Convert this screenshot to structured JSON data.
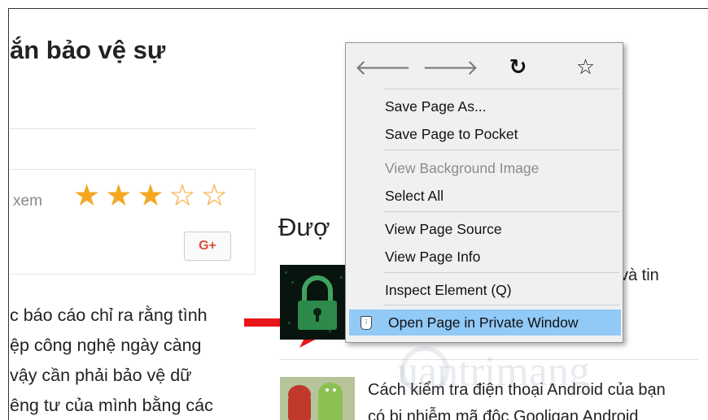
{
  "article": {
    "title": "ắn bảo vệ sự",
    "views_label": "xem",
    "rating": {
      "filled": 3,
      "total": 5
    },
    "share_button": "G+",
    "body_lines": [
      "c báo cáo chỉ ra rằng tình",
      "ệp công nghệ ngày càng",
      " vậy cần phải bảo vệ dữ",
      "êng tư của mình bằng các"
    ]
  },
  "sidebar": {
    "heading": "Đượ",
    "news": [
      {
        "title_fragment": "và tin"
      },
      {
        "title_lines": [
          "Cách kiểm tra điện thoại Android của bạn",
          "có bị nhiễm mã độc Gooligan Android"
        ]
      }
    ],
    "watermark": "uantrimang"
  },
  "context_menu": {
    "nav": [
      {
        "name": "back-icon",
        "glyph": "🡐",
        "enabled": false
      },
      {
        "name": "forward-icon",
        "glyph": "🡒",
        "enabled": false
      },
      {
        "name": "reload-icon",
        "glyph": "↻",
        "enabled": true
      },
      {
        "name": "bookmark-star-icon",
        "glyph": "☆",
        "enabled": true
      }
    ],
    "items": {
      "save_page_as": "Save Page As...",
      "save_to_pocket": "Save Page to Pocket",
      "view_background_image": "View Background Image",
      "select_all": "Select All",
      "view_page_source": "View Page Source",
      "view_page_info": "View Page Info",
      "inspect_element": "Inspect Element (Q)",
      "open_private_window": "Open Page in Private Window"
    },
    "highlight_color": "#91c9f7"
  },
  "annotation": {
    "arrow_color": "#e8141a"
  }
}
